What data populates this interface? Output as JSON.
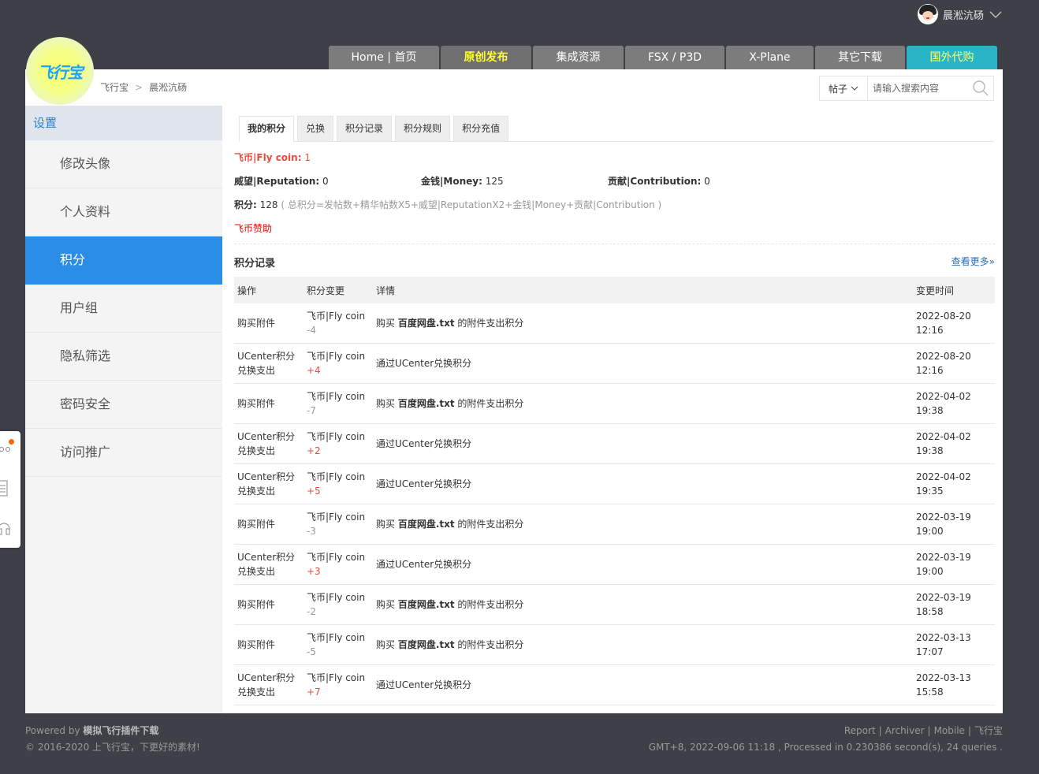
{
  "user": {
    "name": "晨淞沆砀"
  },
  "logo": {
    "text": "飞行宝"
  },
  "nav": [
    {
      "label": "Home | 首页"
    },
    {
      "label": "原创发布"
    },
    {
      "label": "集成资源"
    },
    {
      "label": "FSX / P3D"
    },
    {
      "label": "X-Plane"
    },
    {
      "label": "其它下载"
    },
    {
      "label": "国外代购"
    }
  ],
  "breadcrumb": {
    "root": "飞行宝",
    "current": "晨淞沆砀"
  },
  "search": {
    "type": "帖子",
    "placeholder": "请输入搜索内容"
  },
  "sidebar": {
    "title": "设置",
    "items": [
      {
        "label": "修改头像"
      },
      {
        "label": "个人资料"
      },
      {
        "label": "积分"
      },
      {
        "label": "用户组"
      },
      {
        "label": "隐私筛选"
      },
      {
        "label": "密码安全"
      },
      {
        "label": "访问推广"
      }
    ]
  },
  "tabs": [
    {
      "label": "我的积分"
    },
    {
      "label": "兑换"
    },
    {
      "label": "积分记录"
    },
    {
      "label": "积分规则"
    },
    {
      "label": "积分充值"
    }
  ],
  "credits": {
    "flycoin_label": "飞币|Fly coin:",
    "flycoin_value": "1",
    "reputation_label": "威望|Reputation:",
    "reputation_value": "0",
    "money_label": "金钱|Money:",
    "money_value": "125",
    "contribution_label": "贡献|Contribution:",
    "contribution_value": "0",
    "total_label": "积分:",
    "total_value": "128",
    "formula": "( 总积分=发帖数+精华帖数X5+威望|ReputationX2+金钱|Money+贡献|Contribution )",
    "sponsor": "飞币赞助"
  },
  "log": {
    "title": "积分记录",
    "more": "查看更多»",
    "headers": [
      "操作",
      "积分变更",
      "详情",
      "变更时间"
    ],
    "rows": [
      {
        "op": "购买附件",
        "unit": "飞币|Fly coin",
        "amount": "-4",
        "detail_pre": "购买 ",
        "detail_file": "百度网盘.txt",
        "detail_post": " 的附件支出积分",
        "date": "2022-08-20",
        "time": "12:16"
      },
      {
        "op": "UCenter积分兑换支出",
        "unit": "飞币|Fly coin",
        "amount": "+4",
        "detail_pre": "通过UCenter兑换积分",
        "detail_file": "",
        "detail_post": "",
        "date": "2022-08-20",
        "time": "12:16"
      },
      {
        "op": "购买附件",
        "unit": "飞币|Fly coin",
        "amount": "-7",
        "detail_pre": "购买 ",
        "detail_file": "百度网盘.txt",
        "detail_post": " 的附件支出积分",
        "date": "2022-04-02",
        "time": "19:38"
      },
      {
        "op": "UCenter积分兑换支出",
        "unit": "飞币|Fly coin",
        "amount": "+2",
        "detail_pre": "通过UCenter兑换积分",
        "detail_file": "",
        "detail_post": "",
        "date": "2022-04-02",
        "time": "19:38"
      },
      {
        "op": "UCenter积分兑换支出",
        "unit": "飞币|Fly coin",
        "amount": "+5",
        "detail_pre": "通过UCenter兑换积分",
        "detail_file": "",
        "detail_post": "",
        "date": "2022-04-02",
        "time": "19:35"
      },
      {
        "op": "购买附件",
        "unit": "飞币|Fly coin",
        "amount": "-3",
        "detail_pre": "购买 ",
        "detail_file": "百度网盘.txt",
        "detail_post": " 的附件支出积分",
        "date": "2022-03-19",
        "time": "19:00"
      },
      {
        "op": "UCenter积分兑换支出",
        "unit": "飞币|Fly coin",
        "amount": "+3",
        "detail_pre": "通过UCenter兑换积分",
        "detail_file": "",
        "detail_post": "",
        "date": "2022-03-19",
        "time": "19:00"
      },
      {
        "op": "购买附件",
        "unit": "飞币|Fly coin",
        "amount": "-2",
        "detail_pre": "购买 ",
        "detail_file": "百度网盘.txt",
        "detail_post": " 的附件支出积分",
        "date": "2022-03-19",
        "time": "18:58"
      },
      {
        "op": "购买附件",
        "unit": "飞币|Fly coin",
        "amount": "-5",
        "detail_pre": "购买 ",
        "detail_file": "百度网盘.txt",
        "detail_post": " 的附件支出积分",
        "date": "2022-03-13",
        "time": "17:07"
      },
      {
        "op": "UCenter积分兑换支出",
        "unit": "飞币|Fly coin",
        "amount": "+7",
        "detail_pre": "通过UCenter兑换积分",
        "detail_file": "",
        "detail_post": "",
        "date": "2022-03-13",
        "time": "15:58"
      }
    ]
  },
  "footer": {
    "powered_prefix": "Powered by ",
    "powered_by": "模拟飞行插件下载",
    "copyright": "© 2016-2020 上飞行宝，下更好的素材!",
    "links": [
      "Report",
      "Archiver",
      "Mobile",
      "飞行宝"
    ],
    "status": "GMT+8, 2022-09-06 11:18 , Processed in 0.230386 second(s), 24 queries ."
  },
  "colors": {
    "accent": "#2b8ee6",
    "coin": "#e94b3a",
    "nav_highlight": "#ffff33",
    "nav_cyan": "#2ab5c7"
  }
}
